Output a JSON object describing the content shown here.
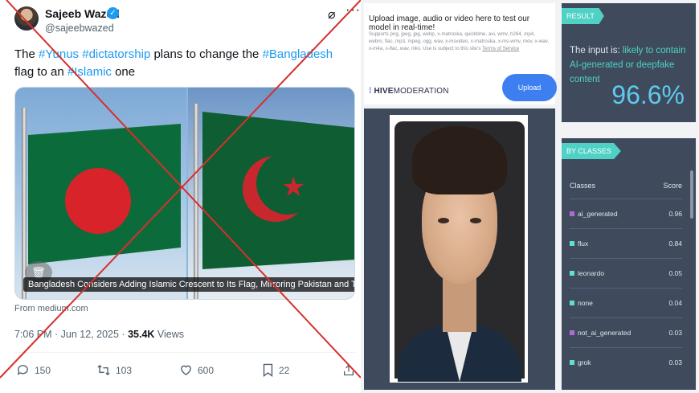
{
  "tweet": {
    "author_name": "Sajeeb Wazed",
    "handle": "@sajeebwazed",
    "text_parts": [
      {
        "t": "The ",
        "tag": false
      },
      {
        "t": "#Yunus",
        "tag": true
      },
      {
        "t": " ",
        "tag": false
      },
      {
        "t": "#dictatorship",
        "tag": true
      },
      {
        "t": " plans to change the ",
        "tag": false
      },
      {
        "t": "#Bangladesh",
        "tag": true
      },
      {
        "t": " flag to an ",
        "tag": false
      },
      {
        "t": "#Islamic",
        "tag": true
      },
      {
        "t": " one",
        "tag": false
      }
    ],
    "media_caption": "Bangladesh Considers Adding Islamic Crescent to Its Flag, Mirroring Pakistan and Turkey",
    "from_link": "From medium.com",
    "timestamp": "7:06 PM · Jun 12, 2025 · ",
    "views_count": "35.4K",
    "views_label": " Views",
    "replies": "150",
    "reposts": "103",
    "likes": "600",
    "bookmarks": "22"
  },
  "hive": {
    "upload_title": "Upload image, audio or video here to test our model in real-time!",
    "upload_desc": "Supports png, jpeg, jpg, webp, x-matroska, quicktime, avi, wmv, h264, mp4, webm, flac, mp3, mpeg, ogg, wav, x-msvideo, x-matroska, x-ms-wmv, mov, x-wav, x-m4a, x-flac, wav, mkv. Use is subject to this site's ",
    "tos_link": "Terms of Service",
    "logo_bold": "HIVE",
    "logo_rest": "MODERATION",
    "upload_button": "Upload",
    "result_badge": "RESULT",
    "result_prefix": "The input is: ",
    "result_highlight": "likely to contain AI-generated or deepfake content",
    "result_score": "96.6%",
    "classes_badge": "BY CLASSES",
    "classes_header": "Classes",
    "score_header": "Score",
    "classes": [
      {
        "name": "ai_generated",
        "score": "0.96",
        "color": "#b06ad8"
      },
      {
        "name": "flux",
        "score": "0.84",
        "color": "#5fe0d0"
      },
      {
        "name": "leonardo",
        "score": "0.05",
        "color": "#5fe0d0"
      },
      {
        "name": "none",
        "score": "0.04",
        "color": "#5fe0d0"
      },
      {
        "name": "not_ai_generated",
        "score": "0.03",
        "color": "#b06ad8"
      },
      {
        "name": "grok",
        "score": "0.03",
        "color": "#5fe0d0"
      }
    ]
  },
  "colors": {
    "twitter_blue": "#1d9bf0",
    "cross_red": "#d6302c",
    "hive_panel": "#3f4b5d",
    "hive_accent": "#4fd1c5"
  }
}
